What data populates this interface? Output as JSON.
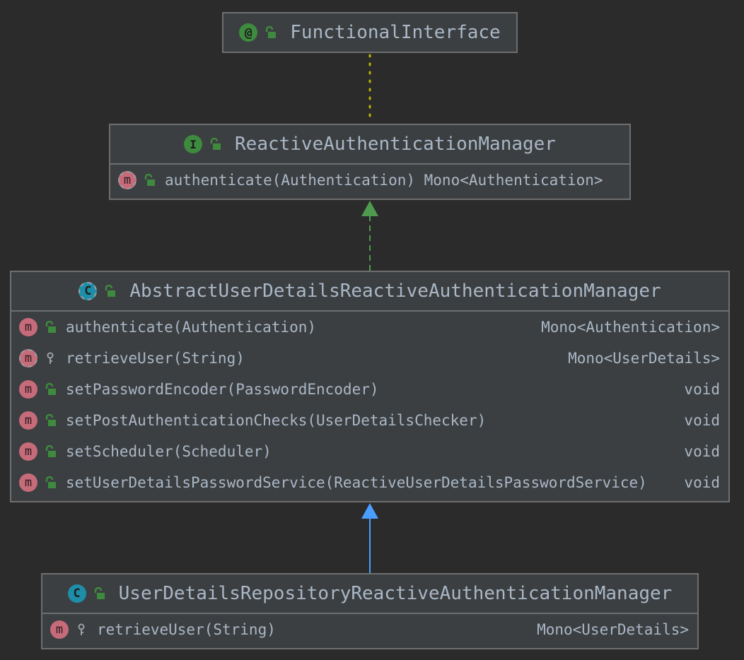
{
  "colors": {
    "background": "#2b2b2b",
    "box_fill": "#3c3f41",
    "box_border": "#6e6e6e",
    "text": "#a9b7c6",
    "annotation_edge": "#b5b500",
    "implements_edge": "#4e9a4e",
    "extends_edge": "#4a9eff"
  },
  "icons": {
    "annotation": "@",
    "interface": "I",
    "class": "C",
    "method": "m",
    "public": "unlock-icon",
    "protected": "key-icon"
  },
  "nodes": {
    "functional_interface": {
      "name": "FunctionalInterface",
      "kind": "annotation"
    },
    "reactive_manager": {
      "name": "ReactiveAuthenticationManager",
      "kind": "interface",
      "methods": [
        {
          "signature": "authenticate(Authentication) Mono<Authentication>",
          "returns": "",
          "visibility": "public",
          "abstract": true
        }
      ]
    },
    "abstract_manager": {
      "name": "AbstractUserDetailsReactiveAuthenticationManager",
      "kind": "abstract-class",
      "methods": [
        {
          "signature": "authenticate(Authentication)",
          "returns": "Mono<Authentication>",
          "visibility": "public",
          "abstract": false
        },
        {
          "signature": "retrieveUser(String)",
          "returns": "Mono<UserDetails>",
          "visibility": "protected",
          "abstract": true
        },
        {
          "signature": "setPasswordEncoder(PasswordEncoder)",
          "returns": "void",
          "visibility": "public",
          "abstract": false
        },
        {
          "signature": "setPostAuthenticationChecks(UserDetailsChecker)",
          "returns": "void",
          "visibility": "public",
          "abstract": false
        },
        {
          "signature": "setScheduler(Scheduler)",
          "returns": "void",
          "visibility": "public",
          "abstract": false
        },
        {
          "signature": "setUserDetailsPasswordService(ReactiveUserDetailsPasswordService)",
          "returns": "void",
          "visibility": "public",
          "abstract": false
        }
      ]
    },
    "repository_manager": {
      "name": "UserDetailsRepositoryReactiveAuthenticationManager",
      "kind": "class",
      "methods": [
        {
          "signature": "retrieveUser(String)",
          "returns": "Mono<UserDetails>",
          "visibility": "protected",
          "abstract": false
        }
      ]
    }
  },
  "edges": [
    {
      "from": "reactive_manager",
      "to": "functional_interface",
      "style": "dotted",
      "color_key": "annotation_edge"
    },
    {
      "from": "abstract_manager",
      "to": "reactive_manager",
      "style": "dashed",
      "color_key": "implements_edge"
    },
    {
      "from": "repository_manager",
      "to": "abstract_manager",
      "style": "solid",
      "color_key": "extends_edge"
    }
  ]
}
